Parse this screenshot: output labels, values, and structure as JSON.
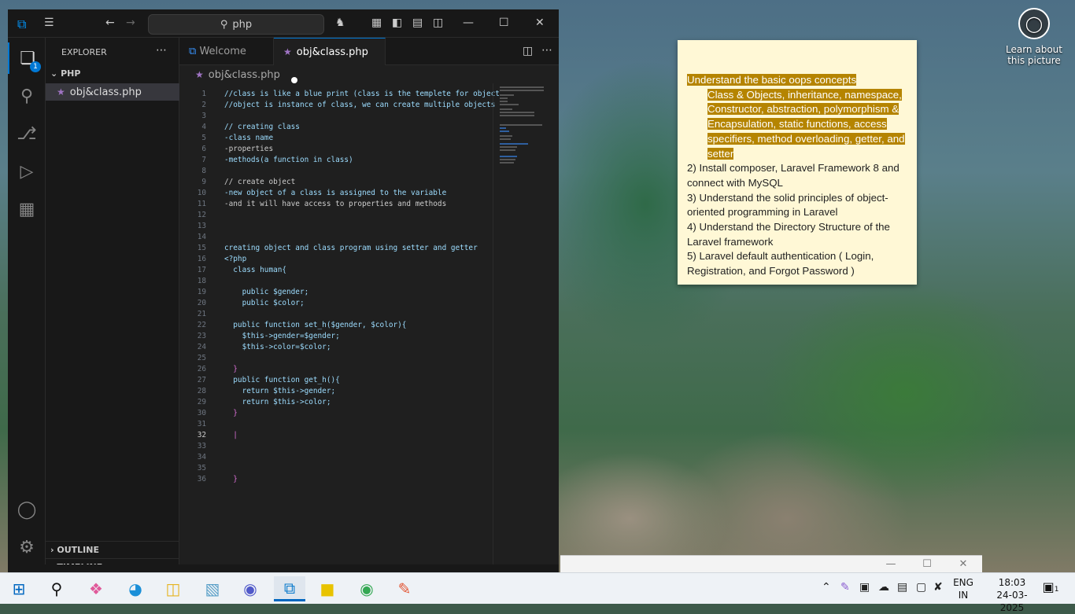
{
  "desktop": {
    "learn_about": "Learn about this picture",
    "learn_icon": "camera-icon"
  },
  "sticky_note": {
    "highlighted_heading": "Understand the basic oops concepts",
    "highlighted_body": "Class & Objects, inheritance, namespace, Constructor, abstraction, polymorphism & Encapsulation, static functions, access specifiers, method overloading, getter, and setter",
    "items": [
      "2) Install composer, Laravel Framework 8 and connect with MySQL",
      "3) Understand the solid principles of object-oriented programming in Laravel",
      "4) Understand the Directory Structure of the Laravel framework",
      "5) Laravel default authentication ( Login, Registration, and Forgot Password )"
    ],
    "highlight_color": "#b58400"
  },
  "vscode": {
    "search_text": "php",
    "explorer_title": "EXPLORER",
    "folder": "PHP",
    "file": "obj&class.php",
    "outline": "OUTLINE",
    "timeline": "TIMELINE",
    "tabs": [
      {
        "label": "Welcome"
      },
      {
        "label": "obj&class.php"
      }
    ],
    "breadcrumb": "obj&class.php",
    "explorer_badge": "1",
    "accent": "#0078d4",
    "lines": [
      {
        "n": "1",
        "t": "//class is like a blue print (class is the templete for object"
      },
      {
        "n": "2",
        "t": "//object is instance of class, we can create multiple objects"
      },
      {
        "n": "3",
        "t": ""
      },
      {
        "n": "4",
        "t": "// creating class"
      },
      {
        "n": "5",
        "t": "-class name"
      },
      {
        "n": "6",
        "t": "-properties"
      },
      {
        "n": "7",
        "t": "-methods(a function in class)"
      },
      {
        "n": "8",
        "t": ""
      },
      {
        "n": "9",
        "t": "// create object"
      },
      {
        "n": "10",
        "t": "-new object of a class is assigned to the variable"
      },
      {
        "n": "11",
        "t": "-and it will have access to properties and methods"
      },
      {
        "n": "12",
        "t": ""
      },
      {
        "n": "13",
        "t": ""
      },
      {
        "n": "14",
        "t": ""
      },
      {
        "n": "15",
        "t": "creating object and class program using setter and getter"
      },
      {
        "n": "16",
        "t": "<?php"
      },
      {
        "n": "17",
        "t": "  class human{"
      },
      {
        "n": "18",
        "t": ""
      },
      {
        "n": "19",
        "t": "    public $gender;"
      },
      {
        "n": "20",
        "t": "    public $color;"
      },
      {
        "n": "21",
        "t": ""
      },
      {
        "n": "22",
        "t": "  public function set_h($gender, $color){"
      },
      {
        "n": "23",
        "t": "    $this->gender=$gender;"
      },
      {
        "n": "24",
        "t": "    $this->color=$color;"
      },
      {
        "n": "25",
        "t": ""
      },
      {
        "n": "26",
        "t": "  }"
      },
      {
        "n": "27",
        "t": "  public function get_h(){"
      },
      {
        "n": "28",
        "t": "    return $this->gender;"
      },
      {
        "n": "29",
        "t": "    return $this->color;"
      },
      {
        "n": "30",
        "t": "  }"
      },
      {
        "n": "31",
        "t": ""
      },
      {
        "n": "32",
        "t": "  |"
      },
      {
        "n": "33",
        "t": ""
      },
      {
        "n": "34",
        "t": ""
      },
      {
        "n": "35",
        "t": ""
      },
      {
        "n": "36",
        "t": "  }"
      }
    ]
  },
  "taskbar": {
    "lang_line1": "ENG",
    "lang_line2": "IN",
    "time": "18:03",
    "date": "24-03-2025",
    "notifications": "1",
    "apps": [
      "windows-start-icon",
      "search-icon",
      "copilot-icon",
      "edge-icon",
      "file-explorer-icon",
      "notepad-icon",
      "teams-icon",
      "vscode-icon",
      "sticky-notes-icon",
      "chrome-icon",
      "paint-icon"
    ]
  }
}
